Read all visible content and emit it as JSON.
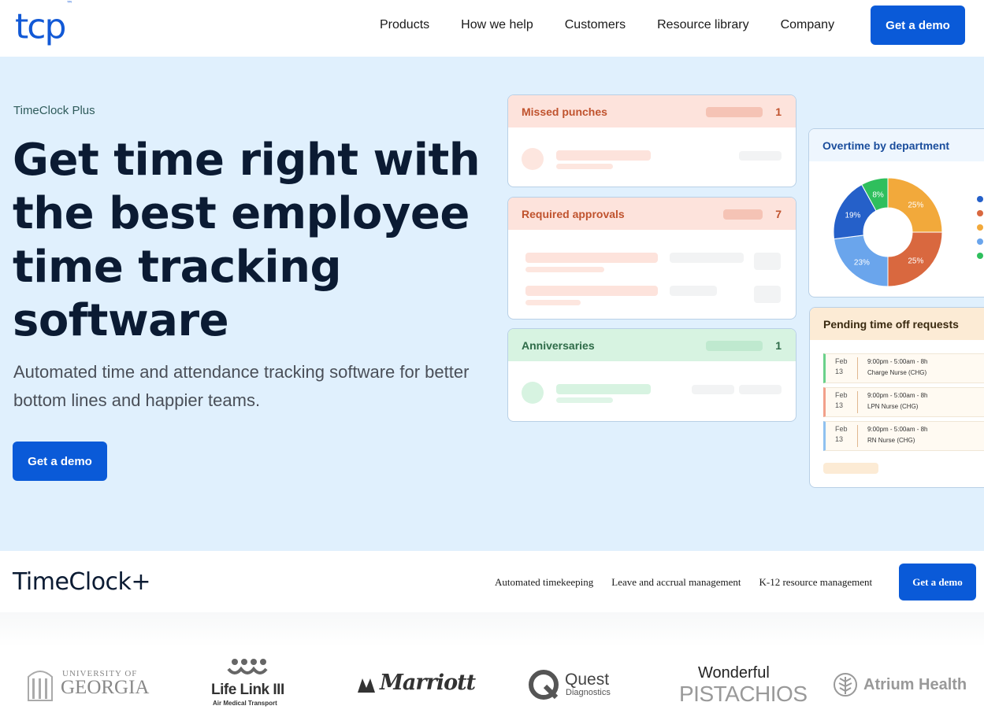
{
  "nav": {
    "logo_text": "tcp",
    "logo_tm": "™",
    "links": [
      "Products",
      "How we help",
      "Customers",
      "Resource library",
      "Company"
    ],
    "cta": "Get a demo"
  },
  "hero": {
    "eyebrow": "TimeClock Plus",
    "headline": "Get time right with the best employee time tracking software",
    "subhead": "Automated time and attendance tracking software for better bottom lines and happier teams.",
    "cta": "Get a demo"
  },
  "cards": {
    "missed": {
      "title": "Missed punches",
      "count": "1"
    },
    "approvals": {
      "title": "Required approvals",
      "count": "7"
    },
    "anniversaries": {
      "title": "Anniversaries",
      "count": "1"
    },
    "overtime": {
      "title": "Overtime by department",
      "slices": [
        {
          "value": 25,
          "label": "25%",
          "color": "#f2a93b"
        },
        {
          "value": 25,
          "label": "25%",
          "color": "#d9683f"
        },
        {
          "value": 23,
          "label": "23%",
          "color": "#6aa5ec"
        },
        {
          "value": 19,
          "label": "19%",
          "color": "#2560c9"
        },
        {
          "value": 8,
          "label": "8%",
          "color": "#2fbf5d"
        }
      ],
      "legend_colors": [
        "#2560c9",
        "#d9683f",
        "#f2a93b",
        "#6aa5ec",
        "#2fbf5d"
      ]
    },
    "pto": {
      "title": "Pending time off requests",
      "rows": [
        {
          "month": "Feb",
          "day": "13",
          "time": "9:00pm - 5:00am - 8h",
          "role": "Charge Nurse (CHG)",
          "color": "#6ad18a"
        },
        {
          "month": "Feb",
          "day": "13",
          "time": "9:00pm - 5:00am - 8h",
          "role": "LPN Nurse (CHG)",
          "color": "#f2a08a"
        },
        {
          "month": "Feb",
          "day": "13",
          "time": "9:00pm - 5:00am - 8h",
          "role": "RN Nurse (CHG)",
          "color": "#8fc1f0"
        }
      ]
    }
  },
  "subnav": {
    "brand": "TimeClock+",
    "links": [
      "Automated timekeeping",
      "Leave and accrual management",
      "K-12 resource management"
    ],
    "cta": "Get a demo"
  },
  "logos": {
    "uga_line1": "UNIVERSITY OF",
    "uga_line2": "GEORGIA",
    "lifelink_name": "Life Link III",
    "lifelink_sub": "Air Medical Transport",
    "marriott": "Marriott",
    "quest_name": "Quest",
    "quest_sub": "Diagnostics",
    "wonderful_line1": "Wonderful",
    "wonderful_line2": "PISTACHIOS",
    "atrium": "Atrium Health"
  }
}
